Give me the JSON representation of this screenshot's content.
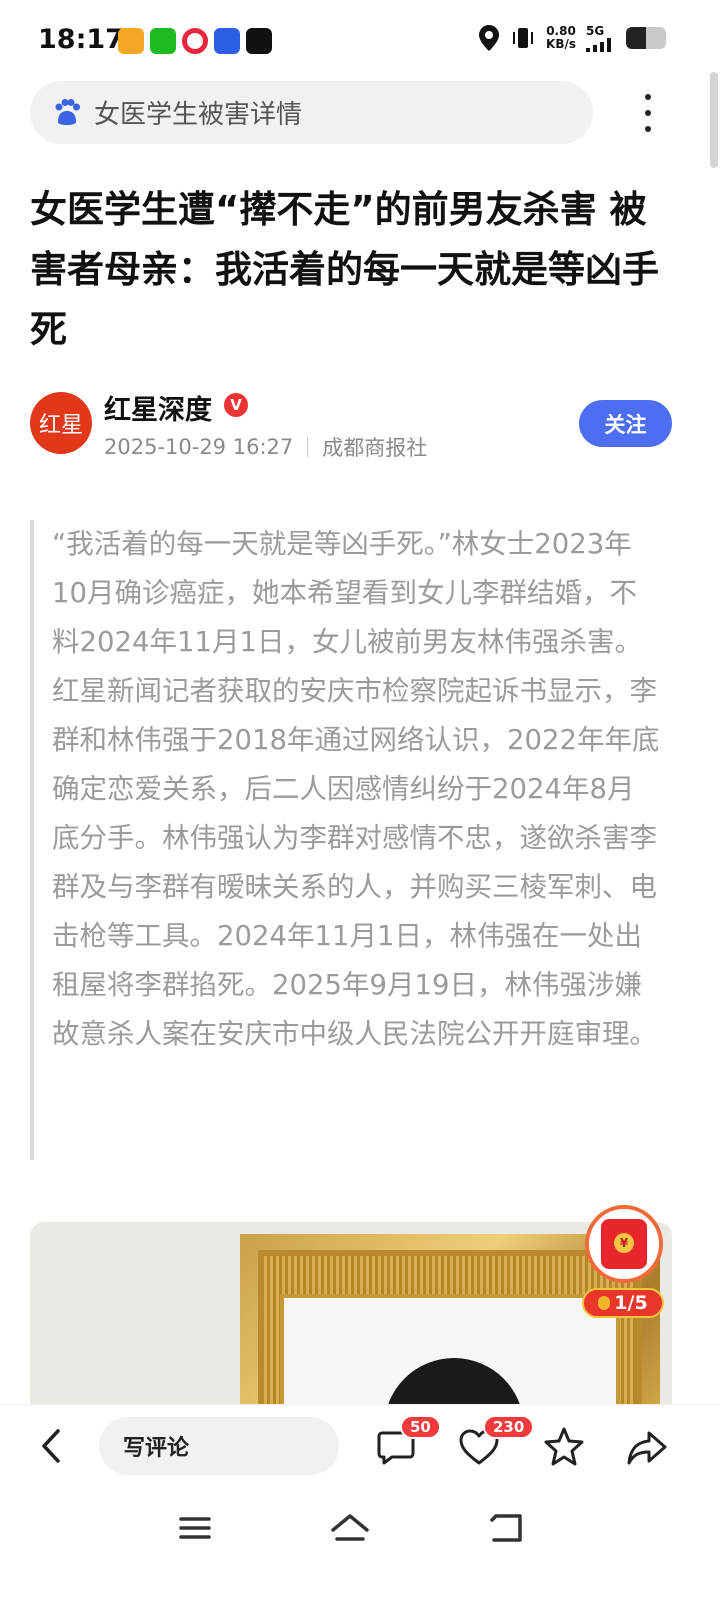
{
  "status_bar": {
    "time": "18:17",
    "net_speed_value": "0.80",
    "net_speed_unit": "KB/s",
    "net_type": "5G",
    "battery_level": 0.5
  },
  "search": {
    "query": "女医学生被害详情"
  },
  "article": {
    "title": "女医学生遭“撵不走”的前男友杀害 被害者母亲：我活着的每一天就是等凶手死",
    "author": {
      "name": "红星深度",
      "avatar_text": "红星",
      "verified_mark": "V",
      "date": "2025-10-29 16:27",
      "source": "成都商报社",
      "follow_label": "关注"
    },
    "quote_paragraphs": [
      "“我活着的每一天就是等凶手死。”林女士2023年10月确诊癌症，她本希望看到女儿李群结婚，不料2024年11月1日，女儿被前男友林伟强杀害。",
      "红星新闻记者获取的安庆市检察院起诉书显示，李群和林伟强于2018年通过网络认识，2022年年底确定恋爱关系，后二人因感情纠纷于2024年8月底分手。林伟强认为李群对感情不忠，遂欲杀害李群及与李群有暧昧关系的人，并购买三棱军刺、电击枪等工具。2024年11月1日，林伟强在一处出租屋将李群掐死。2025年9月19日，林伟强涉嫌故意杀人案在安庆市中级人民法院公开开庭审理。"
    ]
  },
  "red_packet": {
    "coin_symbol": "¥",
    "progress": "1/5"
  },
  "bottom_bar": {
    "comment_placeholder": "写评论",
    "comment_count": "50",
    "like_count": "230"
  },
  "colors": {
    "accent_blue": "#4e6ef2",
    "badge_red": "#f23a3c",
    "avatar_red": "#e2381a",
    "quote_text": "#9b9b9b"
  },
  "icons": [
    "baidu-paw-icon",
    "more-vertical-icon",
    "back-arrow-icon",
    "comment-icon",
    "heart-icon",
    "star-icon",
    "share-icon",
    "menu-icon",
    "home-icon",
    "return-icon",
    "location-icon",
    "vibrate-icon"
  ]
}
